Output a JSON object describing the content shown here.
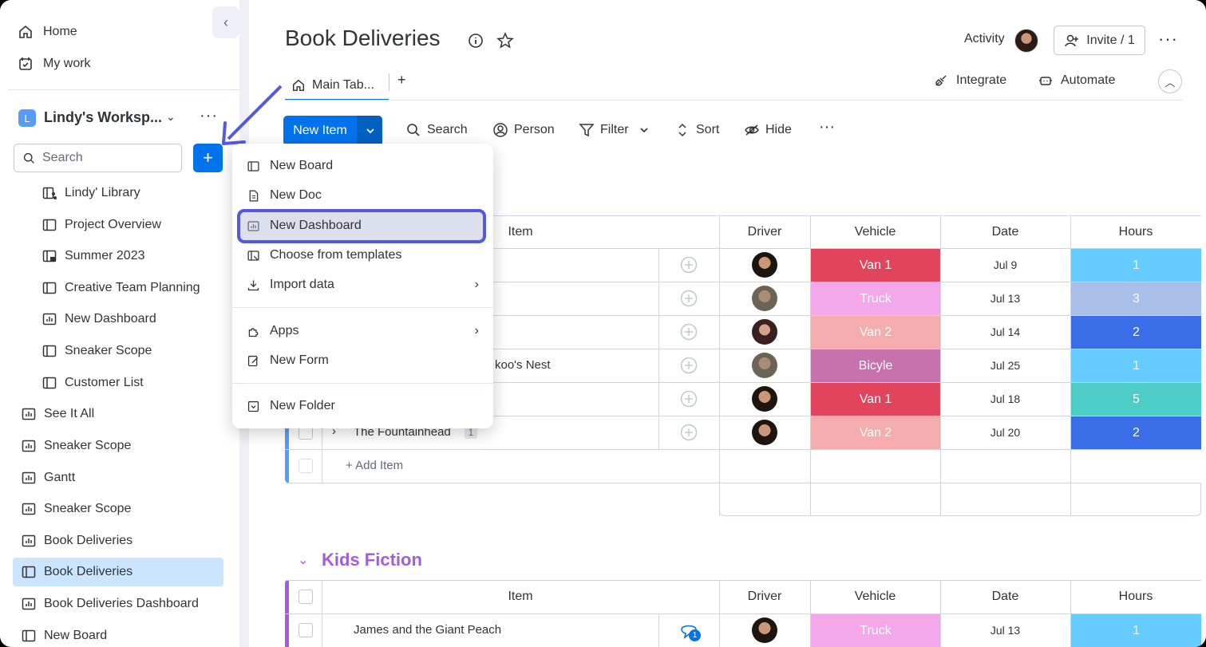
{
  "sidebar": {
    "home": "Home",
    "my_work": "My work",
    "workspace_initial": "L",
    "workspace_name": "Lindy's Worksp...",
    "search_placeholder": "Search",
    "add_label": "+",
    "tree": [
      {
        "label": "Lindy' Library",
        "icon": "library-icon"
      },
      {
        "label": "Project Overview",
        "icon": "board-icon"
      },
      {
        "label": "Summer 2023",
        "icon": "private-board-icon"
      },
      {
        "label": "Creative Team Planning",
        "icon": "board-icon"
      },
      {
        "label": "New Dashboard",
        "icon": "dashboard-icon"
      },
      {
        "label": "Sneaker Scope",
        "icon": "board-icon"
      },
      {
        "label": "Customer List",
        "icon": "board-icon"
      },
      {
        "label": "See It All",
        "icon": "dashboard-icon"
      },
      {
        "label": "Sneaker Scope",
        "icon": "dashboard-icon"
      },
      {
        "label": "Gantt",
        "icon": "dashboard-icon"
      },
      {
        "label": "Sneaker Scope",
        "icon": "dashboard-icon"
      },
      {
        "label": "Book Deliveries",
        "icon": "dashboard-icon"
      },
      {
        "label": "Book Deliveries",
        "icon": "board-icon"
      },
      {
        "label": "Book Deliveries Dashboard",
        "icon": "dashboard-icon"
      },
      {
        "label": "New Board",
        "icon": "board-icon"
      }
    ]
  },
  "header": {
    "title": "Book Deliveries",
    "activity": "Activity",
    "invite": "Invite / 1",
    "tab_main": "Main Tab...",
    "tab_add": "+",
    "integrate": "Integrate",
    "automate": "Automate"
  },
  "toolbar": {
    "new_item": "New Item",
    "search": "Search",
    "person": "Person",
    "filter": "Filter",
    "sort": "Sort",
    "hide": "Hide"
  },
  "menu": {
    "items": [
      {
        "label": "New Board"
      },
      {
        "label": "New Doc"
      },
      {
        "label": "New Dashboard"
      },
      {
        "label": "Choose from templates"
      },
      {
        "label": "Import data"
      },
      {
        "label": "Apps"
      },
      {
        "label": "New Form"
      },
      {
        "label": "New Folder"
      }
    ]
  },
  "table": {
    "headers": {
      "item": "Item",
      "driver": "Driver",
      "vehicle": "Vehicle",
      "date": "Date",
      "hours": "Hours"
    },
    "rows": [
      {
        "item": "",
        "vehicle": "Van 1",
        "vehicle_color": "#e2445c",
        "date": "Jul 9",
        "hours": "1",
        "hours_color": "#66ccff"
      },
      {
        "item": "",
        "vehicle": "Truck",
        "vehicle_color": "#f2a8ea",
        "date": "Jul 13",
        "hours": "3",
        "hours_color": "#a9bee8"
      },
      {
        "item": "",
        "vehicle": "Van 2",
        "vehicle_color": "#f4acac",
        "date": "Jul 14",
        "hours": "2",
        "hours_color": "#3a6ee8"
      },
      {
        "item": "koo's Nest",
        "vehicle": "Bicyle",
        "vehicle_color": "#c872ad",
        "date": "Jul 25",
        "hours": "1",
        "hours_color": "#66ccff"
      },
      {
        "item": "",
        "vehicle": "Van 1",
        "vehicle_color": "#e2445c",
        "date": "Jul 18",
        "hours": "5",
        "hours_color": "#4eccc6"
      },
      {
        "item": "The Fountainhead",
        "subitems": "1",
        "vehicle": "Van 2",
        "vehicle_color": "#f4acac",
        "date": "Jul 20",
        "hours": "2",
        "hours_color": "#3a6ee8"
      }
    ],
    "add_item": "+ Add Item"
  },
  "group2": {
    "title": "Kids Fiction",
    "row": {
      "item": "James and the Giant Peach",
      "updates": "1",
      "vehicle": "Truck",
      "vehicle_color": "#f2a8ea",
      "date": "Jul 13",
      "hours": "1",
      "hours_color": "#66ccff"
    }
  },
  "colors": {
    "accent": "#0073ea",
    "highlight": "#5559df",
    "group_purple": "#a25ddc"
  }
}
